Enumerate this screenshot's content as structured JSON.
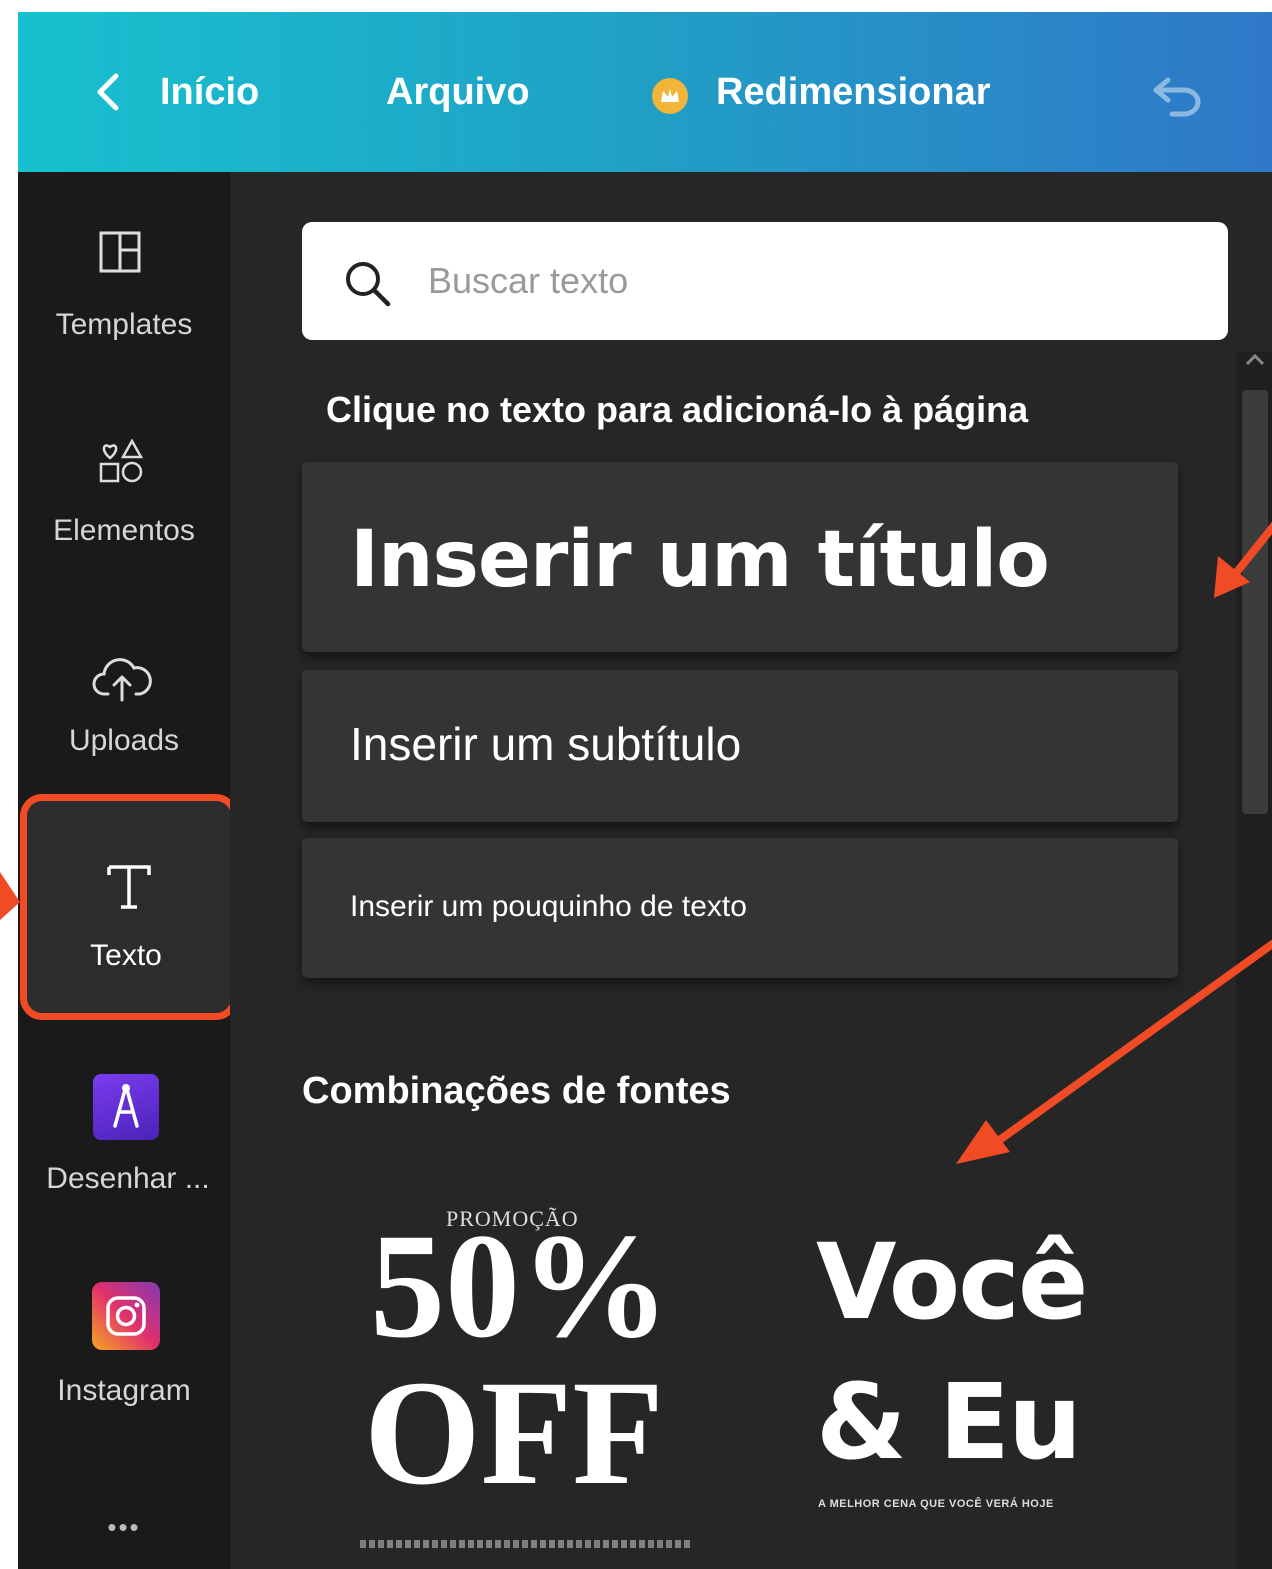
{
  "topbar": {
    "home_label": "Início",
    "file_label": "Arquivo",
    "resize_label": "Redimensionar",
    "gradient_start": "#18c1cf",
    "gradient_end": "#2f78c8",
    "premium_color": "#f2b53a"
  },
  "sidebar": {
    "items": [
      {
        "label": "Templates",
        "icon": "templates-icon"
      },
      {
        "label": "Elementos",
        "icon": "elements-icon"
      },
      {
        "label": "Uploads",
        "icon": "upload-cloud-icon"
      },
      {
        "label": "Texto",
        "icon": "text-icon",
        "selected": true
      },
      {
        "label": "Desenhar ...",
        "icon": "draw-app-icon"
      },
      {
        "label": "Instagram",
        "icon": "instagram-icon"
      }
    ],
    "more_label": "•••"
  },
  "panel": {
    "search_placeholder": "Buscar texto",
    "heading": "Clique no texto para adicioná-lo à página",
    "add_title": "Inserir um título",
    "add_subtitle": "Inserir um subtítulo",
    "add_body": "Inserir um pouquinho de texto",
    "combos_heading": "Combinações de fontes",
    "combos": [
      {
        "small": "PROMOÇÃO",
        "big": "50%",
        "big2": "OFF"
      },
      {
        "line1": "Você",
        "line2": "& Eu",
        "sub": "A MELHOR CENA QUE VOCÊ VERÁ HOJE"
      }
    ]
  },
  "annotation_color": "#f04b24"
}
